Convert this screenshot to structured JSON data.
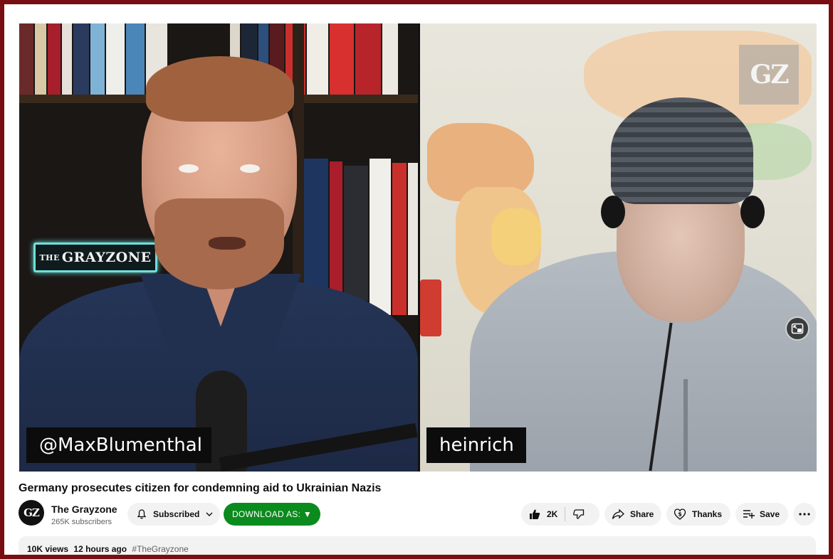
{
  "video": {
    "title": "Germany prosecutes citizen for condemning aid to Ukrainian Nazis",
    "left_nameplate": "@MaxBlumenthal",
    "right_nameplate": "heinrich",
    "watermark": "GZ",
    "sign_text_small": "THE",
    "sign_text": "GRAYZONE"
  },
  "channel": {
    "avatar_text": "GZ",
    "name": "The Grayzone",
    "subscribers": "265K subscribers"
  },
  "actions": {
    "subscribed_label": "Subscribed",
    "download_label": "DOWNLOAD AS: ▼",
    "like_count": "2K",
    "share_label": "Share",
    "thanks_label": "Thanks",
    "save_label": "Save"
  },
  "description": {
    "views": "10K views",
    "uploaded": "12 hours ago",
    "hashtag": "#TheGrayzone"
  },
  "colors": {
    "border": "#7a0d12",
    "download_button": "#0b8a1e"
  },
  "icons": [
    "bell-icon",
    "chevron-down-icon",
    "thumbs-up-icon",
    "thumbs-down-icon",
    "share-icon",
    "thanks-icon",
    "save-playlist-icon",
    "more-icon",
    "pip-icon"
  ]
}
